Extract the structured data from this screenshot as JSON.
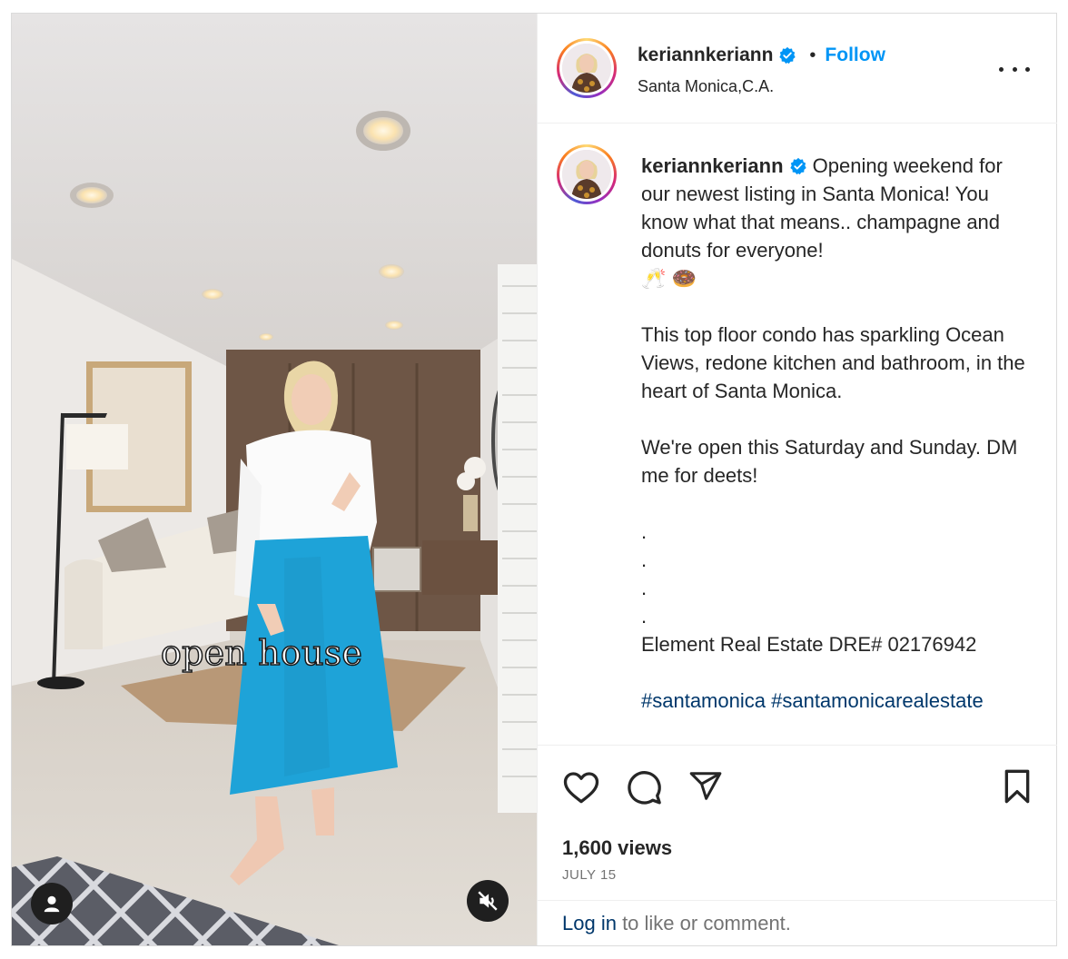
{
  "media": {
    "overlay_text": "open house",
    "user_tag_icon": "user-icon",
    "mute_icon": "volume-muted-icon"
  },
  "header": {
    "username": "keriannkeriann",
    "verified_icon": "verified-badge-icon",
    "separator": "•",
    "follow_label": "Follow",
    "location": "Santa Monica,C.A.",
    "more_icon": "more-options-icon"
  },
  "caption": {
    "username": "keriannkeriann",
    "text_intro": " Opening weekend for our newest listing in Santa Monica! You know what that means.. champagne and donuts for everyone!",
    "emoji": "🥂 🍩",
    "paragraph_2": "This top floor condo has sparkling Ocean Views, redone kitchen and bathroom, in the heart of Santa Monica.",
    "paragraph_3": "We're open this Saturday and Sunday. DM me for deets!",
    "dots": ".\n.\n.\n.",
    "license": "Element Real Estate DRE# 02176942",
    "hashtags": [
      "#santamonica",
      "#santamonicarealestate"
    ]
  },
  "actions": {
    "like_icon": "heart-icon",
    "comment_icon": "comment-icon",
    "share_icon": "paper-plane-icon",
    "save_icon": "bookmark-icon",
    "views": "1,600 views",
    "date": "JULY 15"
  },
  "footer": {
    "login_label": "Log in",
    "login_suffix": " to like or comment."
  },
  "colors": {
    "accent": "#0095f6",
    "link": "#00376b",
    "text": "#262626",
    "muted": "#737373",
    "border": "#dbdbdb",
    "skirt": "#1ea3d8"
  }
}
